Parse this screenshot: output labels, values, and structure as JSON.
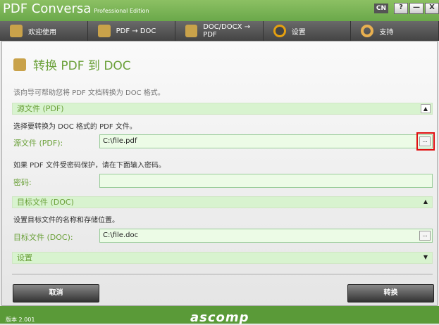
{
  "window": {
    "title": "PDF Conversa",
    "edition": "Professional Edition",
    "lang": "CN",
    "help": "?",
    "minimize": "—",
    "close": "X"
  },
  "tabs": [
    {
      "label": "欢迎使用"
    },
    {
      "label": "PDF → DOC"
    },
    {
      "label": "DOC/DOCX → PDF"
    },
    {
      "label": "设置"
    },
    {
      "label": "支持"
    }
  ],
  "page": {
    "title": "转换 PDF 到 DOC",
    "description": "该向导可帮助您将 PDF 文档转换为 DOC 格式。"
  },
  "source": {
    "section": "源文件 (PDF)",
    "hint": "选择要转换为 DOC 格式的 PDF 文件。",
    "label": "源文件 (PDF):",
    "value": "C:\\file.pdf",
    "browse": "..."
  },
  "password": {
    "hint": "如果 PDF 文件受密码保护，请在下面输入密码。",
    "label": "密码:",
    "value": ""
  },
  "target": {
    "section": "目标文件 (DOC)",
    "hint": "设置目标文件的名称和存储位置。",
    "label": "目标文件 (DOC):",
    "value": "C:\\file.doc",
    "browse": "..."
  },
  "settings": {
    "section": "设置"
  },
  "buttons": {
    "cancel": "取消",
    "convert": "转换"
  },
  "footer": {
    "version": "版本 2.001",
    "logo": "ascomp"
  }
}
